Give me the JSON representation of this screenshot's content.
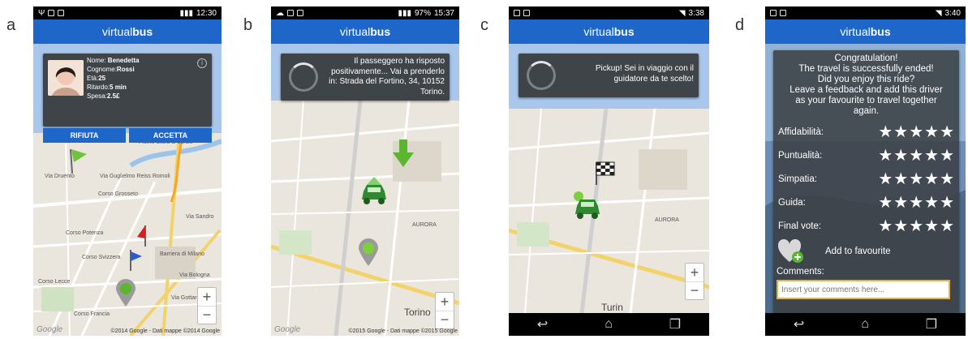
{
  "panel_letters": [
    "a",
    "b",
    "c",
    "d"
  ],
  "app_title": {
    "prefix": "virtual",
    "suffix": "bus"
  },
  "panel_a": {
    "time": "12:30",
    "profile": {
      "name_label": "Nome: ",
      "name": "Benedetta",
      "surname_label": "Cognome:",
      "surname": "Rossi",
      "age_label": "Età:",
      "age": "25",
      "delay_label": "Ritardo:",
      "delay": "5 min",
      "cost_label": "Spesa:",
      "cost": "2.5£"
    },
    "reject_label": "RIFIUTA",
    "accept_label": "ACCETTA",
    "map_labels": [
      "Fiume Stura di Lanzo",
      "Via Guglielmo Reiss Romoli",
      "Corso Grosseto",
      "Via Druento",
      "Via Sandro",
      "Corso Potenza",
      "Corso Svizzera",
      "Barriera di Milano",
      "Via Bologna",
      "Corso Lecce",
      "Corso Francia",
      "Via Gottardo"
    ],
    "copyright": "©2014 Google - Dati mappe ©2014 Google",
    "google": "Google"
  },
  "panel_b": {
    "time": "15:37",
    "battery": "97%",
    "message": "Il passeggero ha risposto positivamente... Vai a prenderlo in: Strada del Fortino, 34, 10152 Torino.",
    "map_city": "Torino",
    "map_labels": [
      "AURORA"
    ],
    "copyright": "©2015 Google - Dati mappe ©2015 Google",
    "google": "Google"
  },
  "panel_c": {
    "time": "3:38",
    "message": "Pickup! Sei in viaggio con il guidatore da te scelto!",
    "map_city": "Turin",
    "map_labels": [
      "AURORA"
    ]
  },
  "panel_d": {
    "time": "3:40",
    "congrats": "Congratulation!",
    "line1": "The travel is successfully ended!",
    "line2": "Did you enjoy this ride?",
    "line3": "Leave a feedback and add this driver",
    "line4": "as your favourite to travel together",
    "line5": "again.",
    "ratings": [
      {
        "label": "Affidabilità:",
        "stars": 5
      },
      {
        "label": "Puntualità:",
        "stars": 5
      },
      {
        "label": "Simpatia:",
        "stars": 5
      },
      {
        "label": "Guida:",
        "stars": 5
      },
      {
        "label": "Final vote:",
        "stars": 5
      }
    ],
    "add_favourite": "Add to favourite",
    "comments_label": "Comments:",
    "comments_placeholder": "Insert your comments here..."
  },
  "colors": {
    "appbar": "#1e66c8",
    "card": "#3f4448",
    "marker_green": "#3aa33a"
  },
  "icons": [
    "profile-photo",
    "info-icon",
    "flag-green-icon",
    "flag-red-icon",
    "flag-blue-icon",
    "location-pin-icon",
    "car-icon",
    "down-arrow-icon",
    "checkered-flag-icon",
    "heart-plus-icon",
    "back-icon",
    "home-icon",
    "recents-icon"
  ]
}
